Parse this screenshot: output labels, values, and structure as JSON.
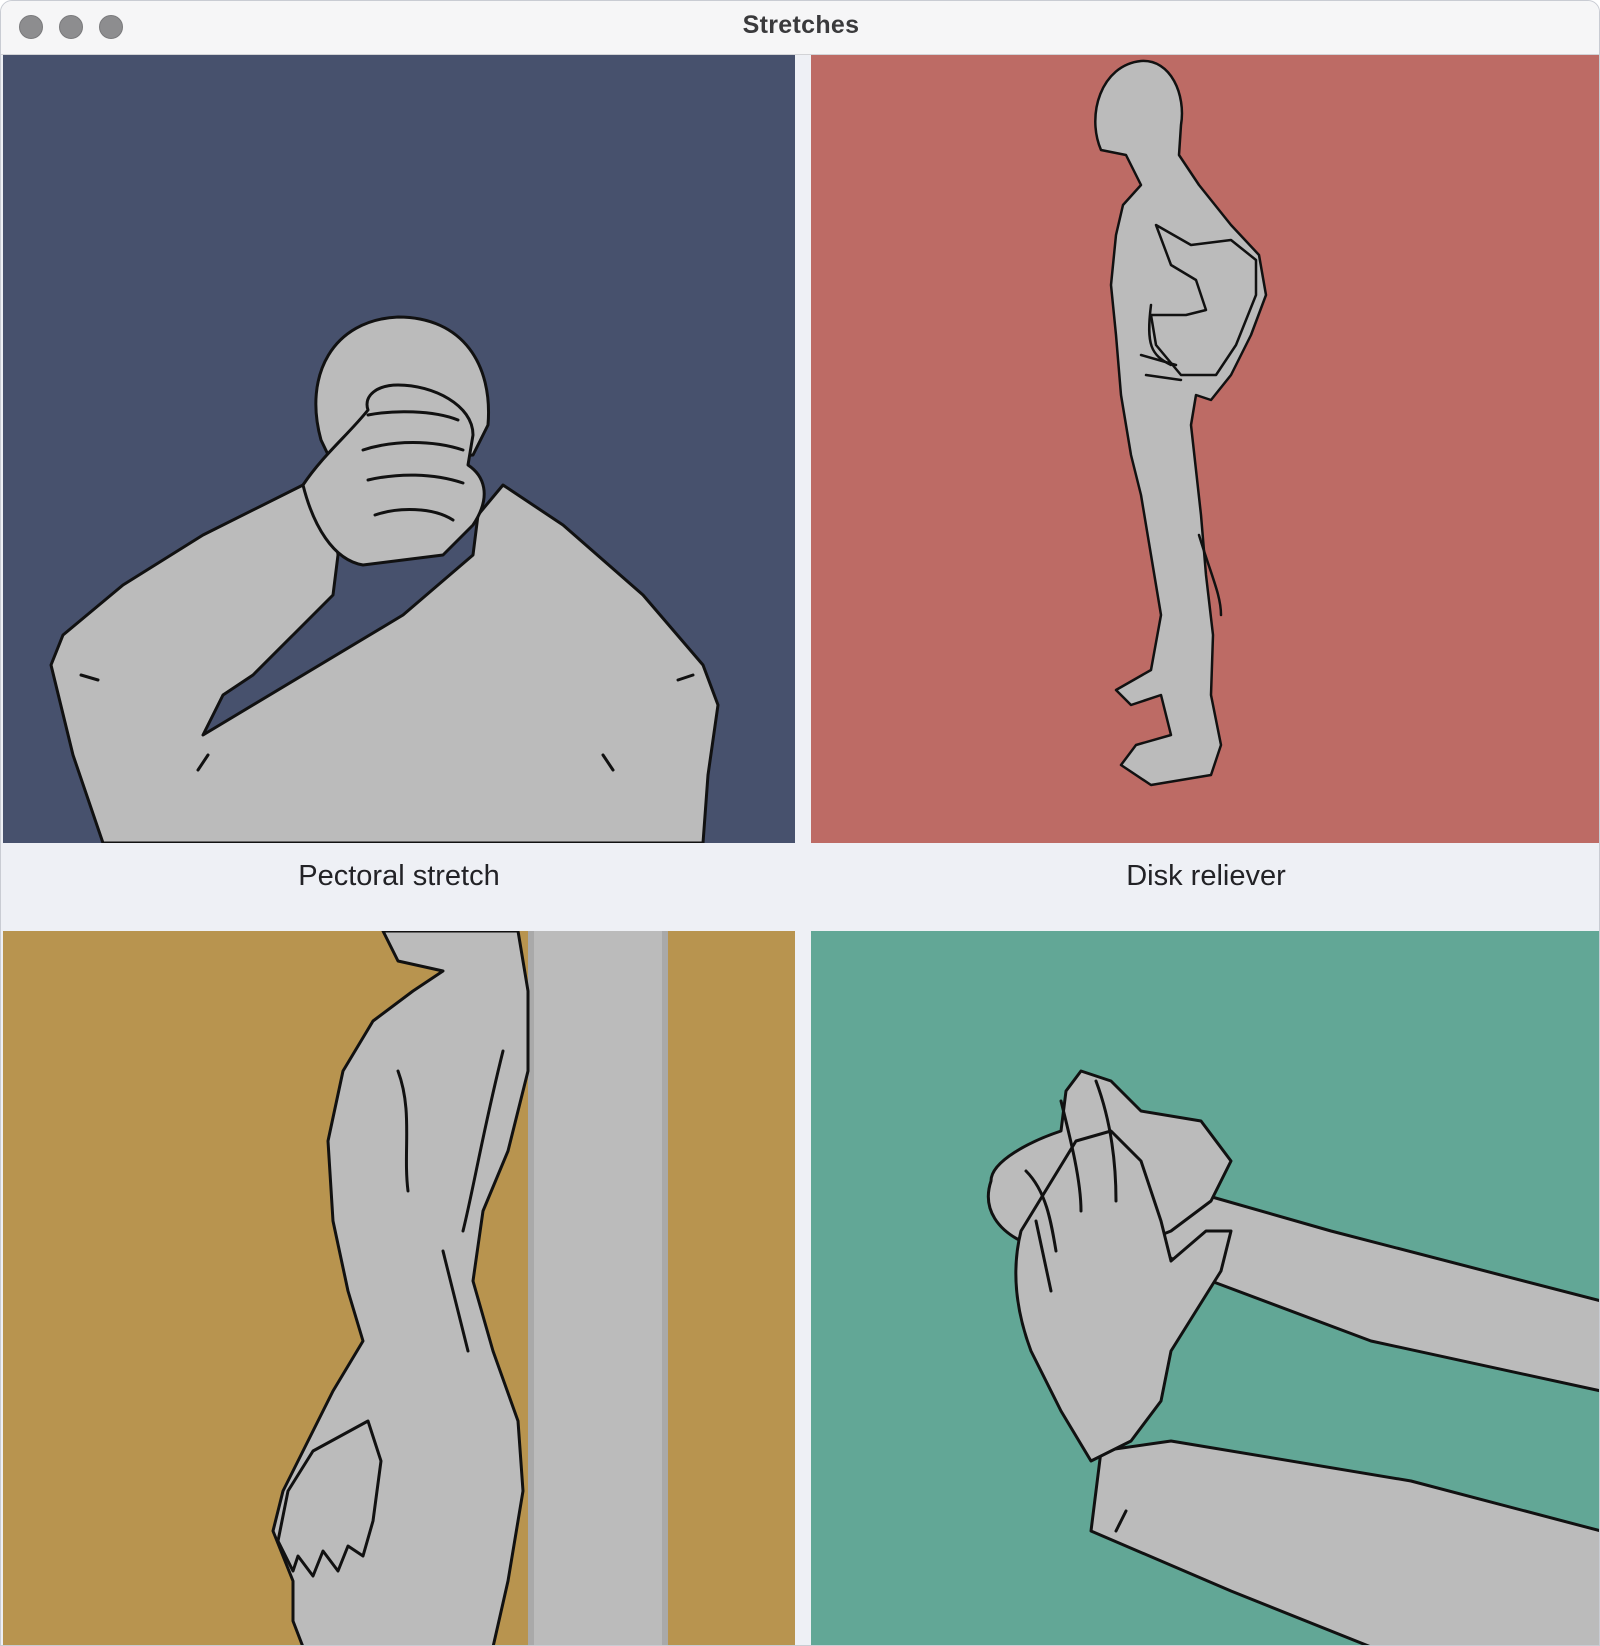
{
  "window": {
    "title": "Stretches"
  },
  "stretches": [
    {
      "label": "Pectoral stretch",
      "color": "#47516d"
    },
    {
      "label": "Disk reliever",
      "color": "#bd6b65"
    },
    {
      "label": "",
      "color": "#b8944f"
    },
    {
      "label": "",
      "color": "#62a796"
    }
  ],
  "figure_fill": "#bbbbbb",
  "outline": "#111111"
}
